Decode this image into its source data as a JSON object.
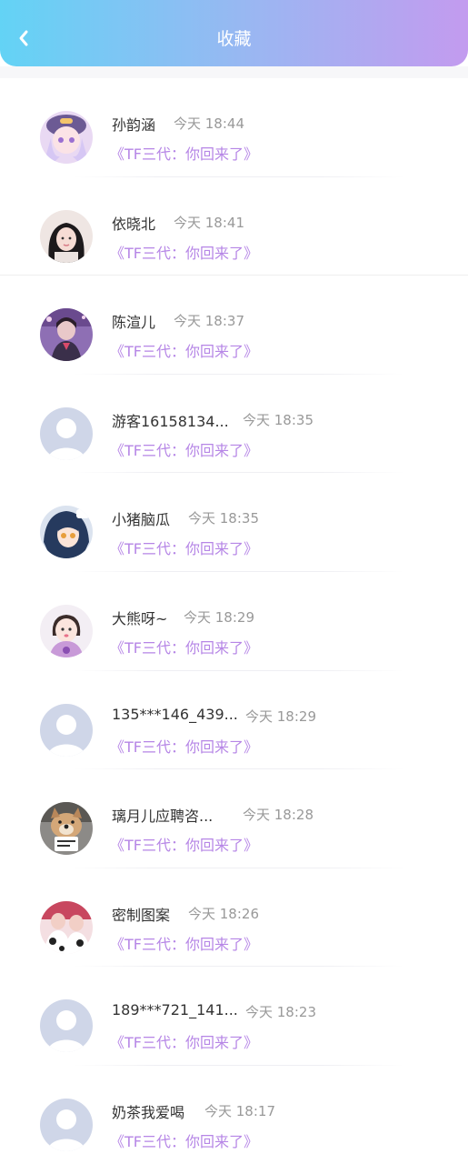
{
  "header": {
    "title": "收藏",
    "back_icon": "chevron-left-icon"
  },
  "colors": {
    "accent": "#b686e6",
    "header_start": "#63d3f5",
    "header_end": "#c39bef"
  },
  "favorites": [
    {
      "user": "孙韵涵",
      "time": "今天 18:44",
      "drama": "《TF三代：你回来了》",
      "avatar": "anime-girl"
    },
    {
      "user": "依晓北",
      "time": "今天 18:41",
      "drama": "《TF三代：你回来了》",
      "avatar": "photo-girl"
    },
    {
      "user": "陈渲儿",
      "time": "今天 18:37",
      "drama": "《TF三代：你回来了》",
      "avatar": "photo-purple"
    },
    {
      "user": "游客16158134...",
      "time": "今天 18:35",
      "drama": "《TF三代：你回来了》",
      "avatar": "default"
    },
    {
      "user": "小猪脑瓜",
      "time": "今天 18:35",
      "drama": "《TF三代：你回来了》",
      "avatar": "anime-boy"
    },
    {
      "user": "大熊呀~",
      "time": "今天 18:29",
      "drama": "《TF三代：你回来了》",
      "avatar": "photo-child"
    },
    {
      "user": "135***146_439...",
      "time": "今天 18:29",
      "drama": "《TF三代：你回来了》",
      "avatar": "default"
    },
    {
      "user": "璃月儿应聘咨...",
      "time": "今天 18:28",
      "drama": "《TF三代：你回来了》",
      "avatar": "dog"
    },
    {
      "user": "密制图案",
      "time": "今天 18:26",
      "drama": "《TF三代：你回来了》",
      "avatar": "photo-cow"
    },
    {
      "user": "189***721_141...",
      "time": "今天 18:23",
      "drama": "《TF三代：你回来了》",
      "avatar": "default"
    },
    {
      "user": "奶茶我爱喝",
      "time": "今天 18:17",
      "drama": "《TF三代：你回来了》",
      "avatar": "default"
    }
  ]
}
